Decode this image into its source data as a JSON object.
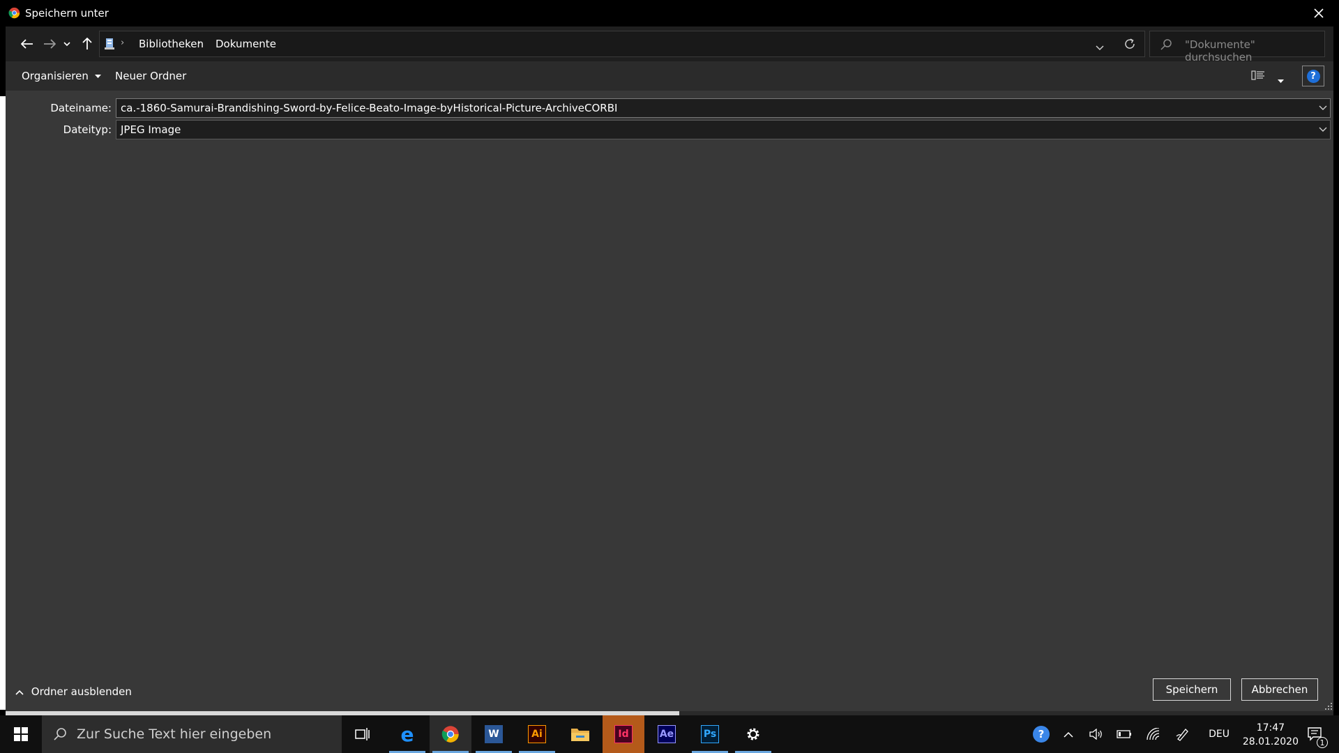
{
  "window": {
    "title": "Speichern unter",
    "close_label": "Schließen"
  },
  "nav": {
    "breadcrumb": [
      "Bibliotheken",
      "Dokumente"
    ],
    "search_placeholder": "\"Dokumente\" durchsuchen"
  },
  "toolbar": {
    "organize_label": "Organisieren",
    "new_folder_label": "Neuer Ordner",
    "help_label": "?"
  },
  "form": {
    "filename_label": "Dateiname:",
    "filename_value": "ca.-1860-Samurai-Brandishing-Sword-by-Felice-Beato-Image-byHistorical-Picture-ArchiveCORBI",
    "filetype_label": "Dateityp:",
    "filetype_value": "JPEG Image"
  },
  "footer": {
    "hide_folders_label": "Ordner ausblenden",
    "save_label": "Speichern",
    "cancel_label": "Abbrechen"
  },
  "taskbar": {
    "search_placeholder": "Zur Suche Text hier eingeben",
    "apps": [
      {
        "name": "task-view",
        "label": ""
      },
      {
        "name": "edge",
        "label": "e"
      },
      {
        "name": "chrome",
        "label": ""
      },
      {
        "name": "word",
        "label": "W"
      },
      {
        "name": "illustrator",
        "label": "Ai"
      },
      {
        "name": "file-explorer",
        "label": ""
      },
      {
        "name": "indesign",
        "label": "Id"
      },
      {
        "name": "after-effects",
        "label": "Ae"
      },
      {
        "name": "photoshop",
        "label": "Ps"
      },
      {
        "name": "settings",
        "label": ""
      }
    ],
    "language": "DEU",
    "time": "17:47",
    "date": "28.01.2020",
    "notification_count": "1"
  },
  "colors": {
    "dialog_bg": "#383838",
    "accent_blue": "#1e6fd9",
    "illustrator": "#ff9a00",
    "indesign": "#ff3366",
    "after_effects": "#9999ff",
    "photoshop": "#31a8ff",
    "word": "#2b5797"
  }
}
